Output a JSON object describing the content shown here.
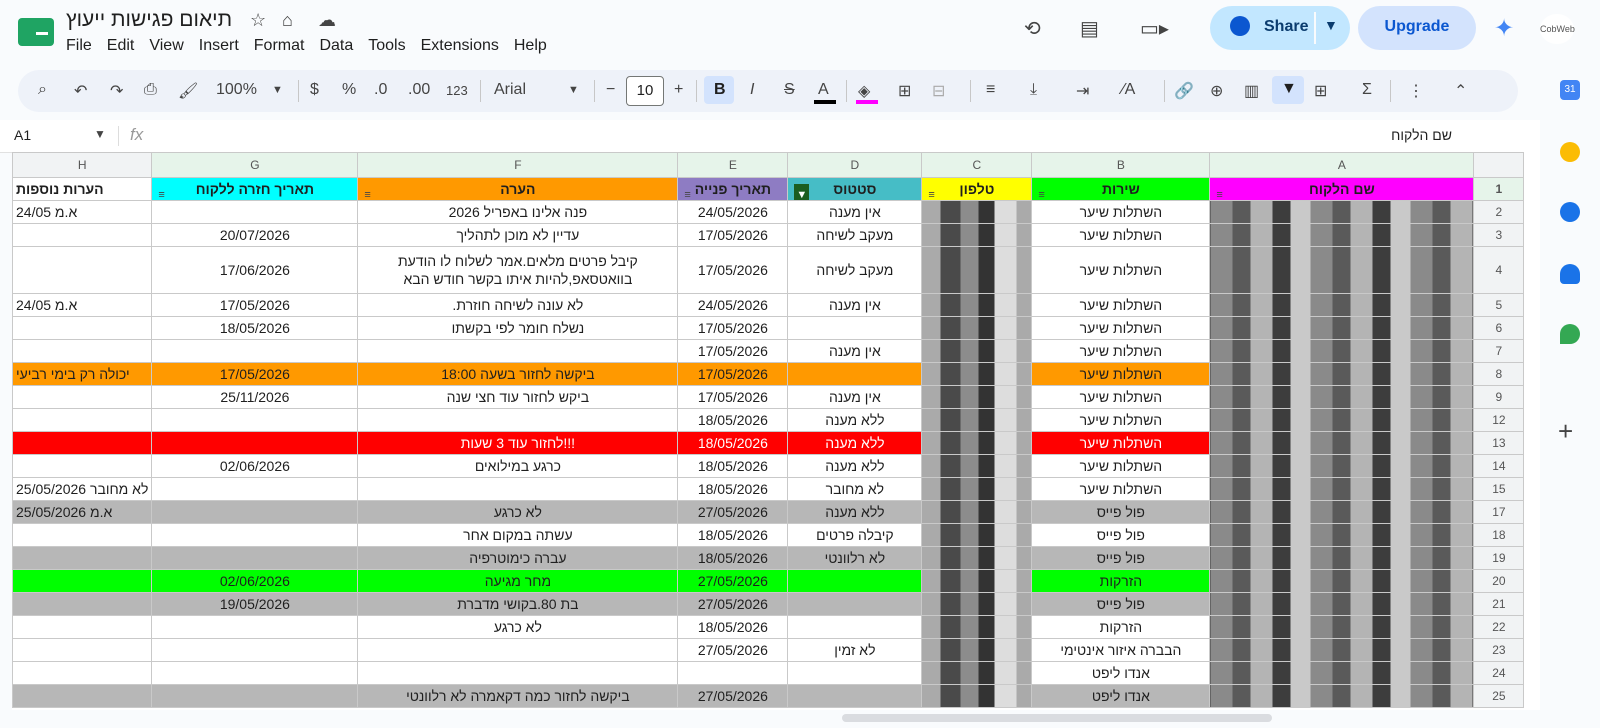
{
  "header": {
    "doc_title": "תיאום פגישות ייעוץ",
    "menu": [
      "File",
      "Edit",
      "View",
      "Insert",
      "Format",
      "Data",
      "Tools",
      "Extensions",
      "Help"
    ],
    "share_label": "Share",
    "upgrade_label": "Upgrade",
    "avatar_text": "CobWeb"
  },
  "toolbar": {
    "zoom": "100%",
    "currency": "$",
    "percent": "%",
    "dec_decrease": ".0",
    "dec_increase": ".00",
    "number_format": "123",
    "font_name": "Arial",
    "font_size": "10",
    "bold": "B",
    "italic": "I",
    "strike": "S",
    "text_color": "A",
    "text_color_hex": "#000000",
    "fill_color_hex": "#ff00ff"
  },
  "formula": {
    "cell_ref": "A1",
    "content": "שם הלקוח",
    "fx": "fx"
  },
  "sheet": {
    "column_letters": [
      "H",
      "G",
      "F",
      "E",
      "D",
      "C",
      "B",
      "A"
    ],
    "headers": [
      {
        "text": "הערות נוספות",
        "bg": "#ffffff"
      },
      {
        "text": "תאריך חזרה ללקוח",
        "bg": "#00ffff"
      },
      {
        "text": "הערה",
        "bg": "#ff9900"
      },
      {
        "text": "תאריך פנייה",
        "bg": "#8e7cc3"
      },
      {
        "text": "סטטוס",
        "bg": "#46bdc6"
      },
      {
        "text": "טלפון",
        "bg": "#ffff00"
      },
      {
        "text": "שירות",
        "bg": "#00ff00"
      },
      {
        "text": "שם הלקוח",
        "bg": "#ff00ff"
      }
    ],
    "rows": [
      {
        "n": "2",
        "bg": "#ffffff",
        "h": "א.מ 24/05",
        "g": "",
        "f": "פנה אלינו באפריל 2026",
        "e": "24/05/2026",
        "d": "אין מענה",
        "b": "השתלות שיער"
      },
      {
        "n": "3",
        "bg": "#ffffff",
        "h": "",
        "g": "20/07/2026",
        "f": "עדיין לא מוכן לתהליך",
        "e": "17/05/2026",
        "d": "מעקב לשיחה",
        "b": "השתלות שיער"
      },
      {
        "n": "4",
        "bg": "#ffffff",
        "tall": true,
        "h": "",
        "g": "17/06/2026",
        "f": "קיבל פרטים מלאים.אמר לשלוח לו הודעת בוואטסאפ,להיות איתו בקשר חודש הבא",
        "e": "17/05/2026",
        "d": "מעקב לשיחה",
        "b": "השתלות שיער"
      },
      {
        "n": "5",
        "bg": "#ffffff",
        "h": "א.מ 24/05",
        "g": "17/05/2026",
        "f": ".לא עונה לשיחה חוזרת",
        "e": "24/05/2026",
        "d": "אין מענה",
        "b": "השתלות שיער"
      },
      {
        "n": "6",
        "bg": "#ffffff",
        "h": "",
        "g": "18/05/2026",
        "f": "נשלח חומר לפי בקשתו",
        "e": "17/05/2026",
        "d": "",
        "b": "השתלות שיער"
      },
      {
        "n": "7",
        "bg": "#ffffff",
        "h": "",
        "g": "",
        "f": "",
        "e": "17/05/2026",
        "d": "אין מענה",
        "b": "השתלות שיער"
      },
      {
        "n": "8",
        "bg": "#ff9900",
        "h": "יכולה רק בימי רביעי",
        "g": "17/05/2026",
        "f": "ביקשה לחזור בשעה 18:00",
        "e": "17/05/2026",
        "d": "",
        "b": "השתלות שיער"
      },
      {
        "n": "9",
        "bg": "#ffffff",
        "h": "",
        "g": "25/11/2026",
        "f": "ביקש לחזור עוד חצי שנה",
        "e": "17/05/2026",
        "d": "אין מענה",
        "b": "השתלות שיער"
      },
      {
        "n": "12",
        "bg": "#ffffff",
        "h": "",
        "g": "",
        "f": "",
        "e": "18/05/2026",
        "d": "ללא מענה",
        "b": "השתלות שיער"
      },
      {
        "n": "13",
        "bg": "#ff0000",
        "fg": "#ffffff",
        "h": "",
        "g": "",
        "f": "לחזור עוד 3 שעות!!!",
        "e": "18/05/2026",
        "d": "ללא מענה",
        "b": "השתלות שיער"
      },
      {
        "n": "14",
        "bg": "#ffffff",
        "h": "",
        "g": "02/06/2026",
        "f": "כרגע במילואים",
        "e": "18/05/2026",
        "d": "ללא מענה",
        "b": "השתלות שיער"
      },
      {
        "n": "15",
        "bg": "#ffffff",
        "h": "לא מחובר 25/05/2026",
        "g": "",
        "f": "",
        "e": "18/05/2026",
        "d": "לא מחובר",
        "b": "השתלות שיער"
      },
      {
        "n": "17",
        "bg": "#b7b7b7",
        "h": "א.מ 25/05/2026",
        "g": "",
        "f": "לא כרגע",
        "e": "27/05/2026",
        "d": "ללא מענה",
        "b": "פול פייס"
      },
      {
        "n": "18",
        "bg": "#ffffff",
        "h": "",
        "g": "",
        "f": "עשתה במקום אחר",
        "e": "18/05/2026",
        "d": "קיבלה פרטים",
        "b": "פול פייס"
      },
      {
        "n": "19",
        "bg": "#b7b7b7",
        "h": "",
        "g": "",
        "f": "עברה כימוטרפיה",
        "e": "18/05/2026",
        "d": "לא רלוונטי",
        "b": "פול פייס"
      },
      {
        "n": "20",
        "bg": "#00ff00",
        "h": "",
        "g": "02/06/2026",
        "f": "מחר מגיעה",
        "e": "27/05/2026",
        "d": "",
        "b": "הזרקות"
      },
      {
        "n": "21",
        "bg": "#b7b7b7",
        "h": "",
        "g": "19/05/2026",
        "f": "בת 80.בקושי מדברת",
        "e": "27/05/2026",
        "d": "",
        "b": "פול פייס"
      },
      {
        "n": "22",
        "bg": "#ffffff",
        "h": "",
        "g": "",
        "f": "לא כרגע",
        "e": "18/05/2026",
        "d": "",
        "b": "הזרקות"
      },
      {
        "n": "23",
        "bg": "#ffffff",
        "h": "",
        "g": "",
        "f": "",
        "e": "27/05/2026",
        "d": "לא זמין",
        "b": "הבברה איזור אינטימי"
      },
      {
        "n": "24",
        "bg": "#ffffff",
        "h": "",
        "g": "",
        "f": "",
        "e": "",
        "d": "",
        "b": "אנדו ליפט"
      },
      {
        "n": "25",
        "bg": "#b7b7b7",
        "h": "",
        "g": "",
        "f": "ביקשה לחזור כמה דקאמרה לא רלוונטי",
        "e": "27/05/2026",
        "d": "",
        "b": "אנדו ליפט"
      }
    ]
  }
}
